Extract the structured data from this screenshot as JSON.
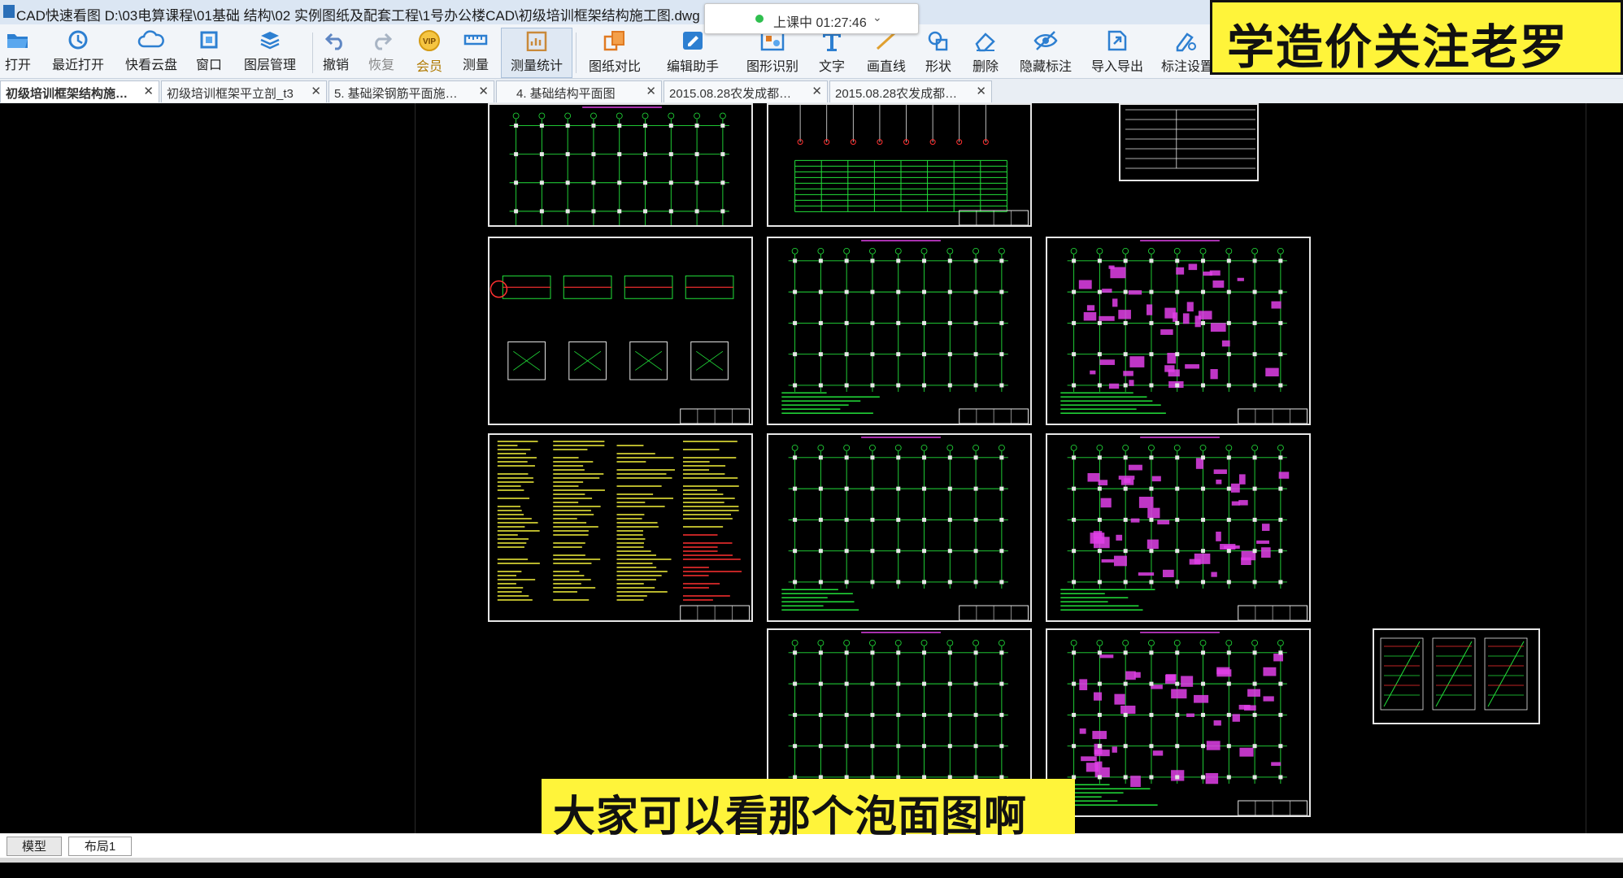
{
  "window": {
    "title": "CAD快速看图    D:\\03电算课程\\01基础 结构\\02 实例图纸及配套工程\\1号办公楼CAD\\初级培训框架结构施工图.dwg"
  },
  "status_pill": {
    "text": "上课中 01:27:46"
  },
  "banner": {
    "text": "学造价关注老罗"
  },
  "toolbar": {
    "items": [
      {
        "label": "打开",
        "icon": "folder-open-icon"
      },
      {
        "label": "最近打开",
        "icon": "history-icon"
      },
      {
        "label": "快看云盘",
        "icon": "cloud-icon"
      },
      {
        "label": "窗口",
        "icon": "window-icon"
      },
      {
        "label": "图层管理",
        "icon": "layers-icon"
      },
      {
        "label": "撤销",
        "icon": "undo-icon"
      },
      {
        "label": "恢复",
        "icon": "redo-icon"
      },
      {
        "label": "会员",
        "icon": "vip-icon"
      },
      {
        "label": "测量",
        "icon": "ruler-icon"
      },
      {
        "label": "测量统计",
        "icon": "measure-stats-icon"
      },
      {
        "label": "图纸对比",
        "icon": "compare-icon"
      },
      {
        "label": "编辑助手",
        "icon": "edit-assistant-icon"
      },
      {
        "label": "图形识别",
        "icon": "shape-recognize-icon"
      },
      {
        "label": "文字",
        "icon": "text-icon"
      },
      {
        "label": "画直线",
        "icon": "line-icon"
      },
      {
        "label": "形状",
        "icon": "shape-icon"
      },
      {
        "label": "删除",
        "icon": "eraser-icon"
      },
      {
        "label": "隐藏标注",
        "icon": "hide-annotation-icon"
      },
      {
        "label": "导入导出",
        "icon": "import-export-icon"
      },
      {
        "label": "标注设置",
        "icon": "annotation-settings-icon"
      }
    ]
  },
  "tabs": [
    {
      "label": "初级培训框架结构施…",
      "active": true
    },
    {
      "label": "初级培训框架平立剖_t3",
      "active": false
    },
    {
      "label": "5. 基础梁钢筋平面施…",
      "active": false
    },
    {
      "label": "4. 基础结构平面图",
      "active": false
    },
    {
      "label": "2015.08.28农发成都…",
      "active": false
    },
    {
      "label": "2015.08.28农发成都…",
      "active": false
    }
  ],
  "layout_tabs": {
    "model": "模型",
    "layout1": "布局1"
  },
  "subtitle": {
    "text": "大家可以看那个泡面图啊"
  },
  "colors": {
    "canvas": "#000000",
    "frame": "#e6e6e6",
    "green": "#22e03a",
    "magenta": "#e040e8",
    "yellow": "#f4f13a",
    "red": "#ff3030",
    "cyan": "#40e0ff",
    "banner_bg": "#fff43a"
  },
  "drawing_sheets": [
    {
      "kind": "foundation-detail"
    },
    {
      "kind": "table-sheet"
    },
    {
      "kind": "title-table"
    },
    {
      "kind": "section-details"
    },
    {
      "kind": "floor-plan"
    },
    {
      "kind": "rebar-plan"
    },
    {
      "kind": "notes"
    },
    {
      "kind": "floor-plan"
    },
    {
      "kind": "rebar-plan"
    },
    {
      "kind": "floor-plan"
    },
    {
      "kind": "rebar-plan"
    },
    {
      "kind": "stair-details"
    }
  ]
}
